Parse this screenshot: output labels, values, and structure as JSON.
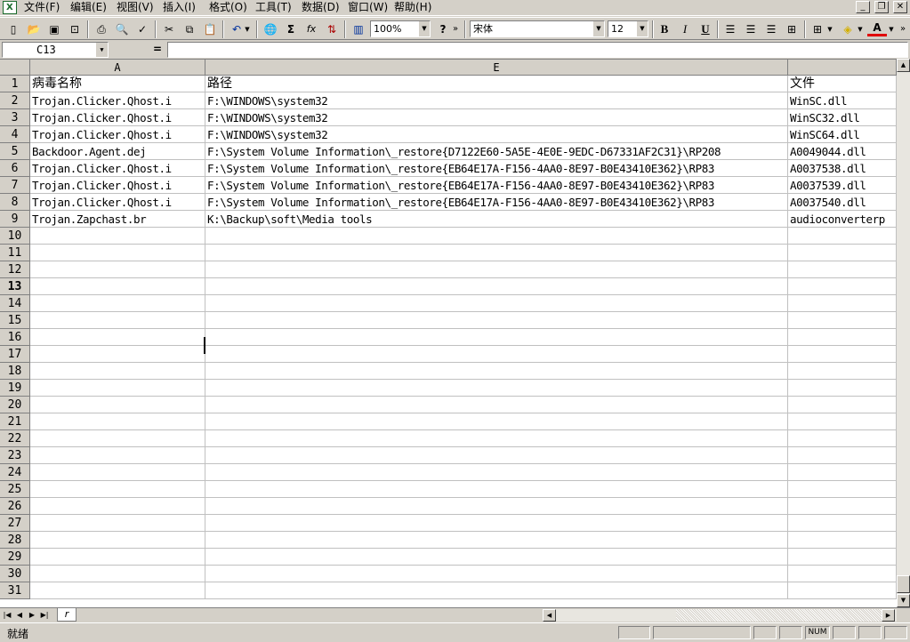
{
  "menu": {
    "items": [
      "文件(F)",
      "编辑(E)",
      "视图(V)",
      "插入(I)",
      "格式(O)",
      "工具(T)",
      "数据(D)",
      "窗口(W)",
      "帮助(H)"
    ]
  },
  "window_controls": {
    "minimize": "_",
    "restore": "❐",
    "close": "✕"
  },
  "toolbar": {
    "icons": [
      "new-icon",
      "open-icon",
      "save-icon",
      "permission-icon",
      "print-icon",
      "print-preview-icon",
      "spelling-icon",
      "cut-icon",
      "copy-icon",
      "paste-icon",
      "undo-icon",
      "hyperlink-icon",
      "autosum-icon",
      "function-icon",
      "sort-icon",
      "chart-icon",
      "help-icon",
      "bold-icon",
      "italic-icon",
      "underline-icon",
      "align-left-icon",
      "align-center-icon",
      "align-right-icon",
      "merge-center-icon",
      "borders-icon",
      "fill-color-icon",
      "font-color-icon"
    ],
    "zoom": "100%",
    "font_name": "宋体",
    "font_size": "12",
    "bold": "B",
    "italic": "I",
    "underline": "U",
    "sum": "Σ",
    "fx": "fx"
  },
  "formula_bar": {
    "name_box": "C13",
    "equals": "=",
    "value": ""
  },
  "columns": [
    {
      "label": "A"
    },
    {
      "label": "E"
    },
    {
      "label": ""
    }
  ],
  "rows": [
    {
      "n": "1",
      "cells": [
        "病毒名称",
        "路径",
        "文件"
      ],
      "header": true
    },
    {
      "n": "2",
      "cells": [
        "Trojan.Clicker.Qhost.i",
        "F:\\WINDOWS\\system32",
        "WinSC.dll"
      ]
    },
    {
      "n": "3",
      "cells": [
        "Trojan.Clicker.Qhost.i",
        "F:\\WINDOWS\\system32",
        "WinSC32.dll"
      ]
    },
    {
      "n": "4",
      "cells": [
        "Trojan.Clicker.Qhost.i",
        "F:\\WINDOWS\\system32",
        "WinSC64.dll"
      ]
    },
    {
      "n": "5",
      "cells": [
        "Backdoor.Agent.dej",
        "F:\\System Volume Information\\_restore{D7122E60-5A5E-4E0E-9EDC-D67331AF2C31}\\RP208",
        "A0049044.dll"
      ]
    },
    {
      "n": "6",
      "cells": [
        "Trojan.Clicker.Qhost.i",
        "F:\\System Volume Information\\_restore{EB64E17A-F156-4AA0-8E97-B0E43410E362}\\RP83",
        "A0037538.dll"
      ]
    },
    {
      "n": "7",
      "cells": [
        "Trojan.Clicker.Qhost.i",
        "F:\\System Volume Information\\_restore{EB64E17A-F156-4AA0-8E97-B0E43410E362}\\RP83",
        "A0037539.dll"
      ]
    },
    {
      "n": "8",
      "cells": [
        "Trojan.Clicker.Qhost.i",
        "F:\\System Volume Information\\_restore{EB64E17A-F156-4AA0-8E97-B0E43410E362}\\RP83",
        "A0037540.dll"
      ]
    },
    {
      "n": "9",
      "cells": [
        "Trojan.Zapchast.br",
        "K:\\Backup\\soft\\Media tools",
        "audioconverterp"
      ]
    },
    {
      "n": "10",
      "cells": [
        "",
        "",
        ""
      ]
    },
    {
      "n": "11",
      "cells": [
        "",
        "",
        ""
      ]
    },
    {
      "n": "12",
      "cells": [
        "",
        "",
        ""
      ]
    },
    {
      "n": "13",
      "cells": [
        "",
        "",
        ""
      ],
      "selected": true
    },
    {
      "n": "14",
      "cells": [
        "",
        "",
        ""
      ]
    },
    {
      "n": "15",
      "cells": [
        "",
        "",
        ""
      ]
    },
    {
      "n": "16",
      "cells": [
        "",
        "",
        ""
      ]
    },
    {
      "n": "17",
      "cells": [
        "",
        "",
        ""
      ]
    },
    {
      "n": "18",
      "cells": [
        "",
        "",
        ""
      ]
    },
    {
      "n": "19",
      "cells": [
        "",
        "",
        ""
      ]
    },
    {
      "n": "20",
      "cells": [
        "",
        "",
        ""
      ]
    },
    {
      "n": "21",
      "cells": [
        "",
        "",
        ""
      ]
    },
    {
      "n": "22",
      "cells": [
        "",
        "",
        ""
      ]
    },
    {
      "n": "23",
      "cells": [
        "",
        "",
        ""
      ]
    },
    {
      "n": "24",
      "cells": [
        "",
        "",
        ""
      ]
    },
    {
      "n": "25",
      "cells": [
        "",
        "",
        ""
      ]
    },
    {
      "n": "26",
      "cells": [
        "",
        "",
        ""
      ]
    },
    {
      "n": "27",
      "cells": [
        "",
        "",
        ""
      ]
    },
    {
      "n": "28",
      "cells": [
        "",
        "",
        ""
      ]
    },
    {
      "n": "29",
      "cells": [
        "",
        "",
        ""
      ]
    },
    {
      "n": "30",
      "cells": [
        "",
        "",
        ""
      ]
    },
    {
      "n": "31",
      "cells": [
        "",
        "",
        ""
      ]
    }
  ],
  "sheet_tabs": [
    "r"
  ],
  "status": {
    "text": "就绪",
    "num": "NUM"
  }
}
